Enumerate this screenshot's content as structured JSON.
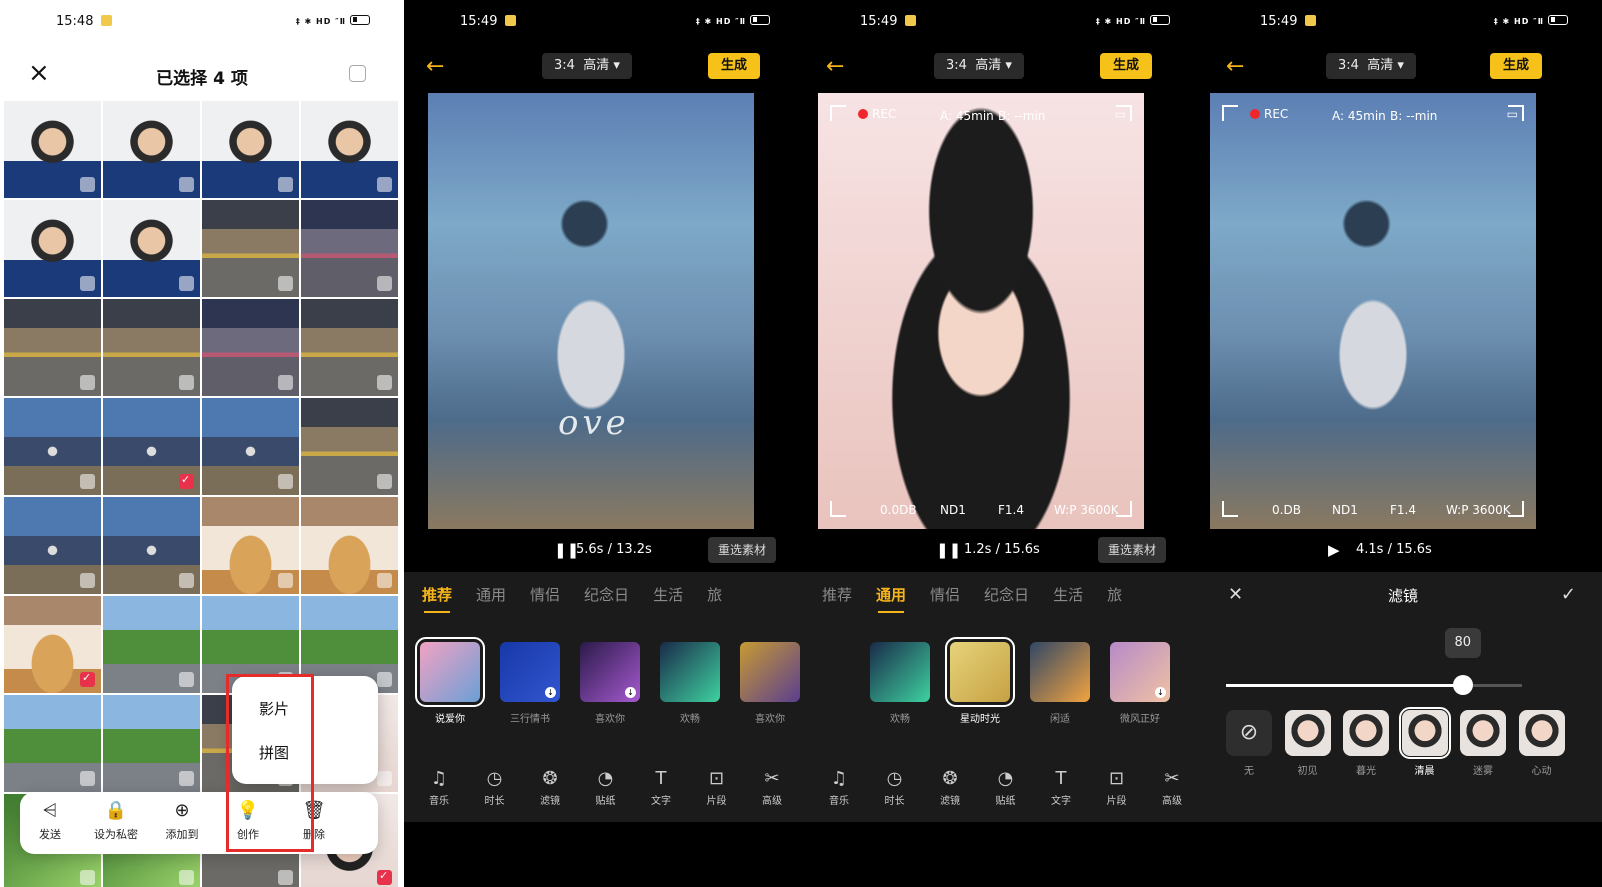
{
  "screen1": {
    "time": "15:48",
    "status_icons": "‡ ✱ HD ″Ⅱ",
    "title": "已选择 4 项",
    "grid": [
      {
        "type": "p-face",
        "checked": false
      },
      {
        "type": "p-face",
        "checked": false
      },
      {
        "type": "p-face",
        "checked": false
      },
      {
        "type": "p-face",
        "checked": false
      },
      {
        "type": "p-face",
        "checked": false
      },
      {
        "type": "p-face",
        "checked": false
      },
      {
        "type": "p-street",
        "checked": false
      },
      {
        "type": "p-street2",
        "checked": false
      },
      {
        "type": "p-street",
        "checked": false
      },
      {
        "type": "p-street",
        "checked": false
      },
      {
        "type": "p-street2",
        "checked": false
      },
      {
        "type": "p-street",
        "checked": false
      },
      {
        "type": "p-night",
        "checked": false
      },
      {
        "type": "p-night",
        "checked": true
      },
      {
        "type": "p-night",
        "checked": false
      },
      {
        "type": "p-street",
        "checked": false
      },
      {
        "type": "p-night",
        "checked": false
      },
      {
        "type": "p-night",
        "checked": false
      },
      {
        "type": "p-cup",
        "checked": false
      },
      {
        "type": "p-cup",
        "checked": false
      },
      {
        "type": "p-cup",
        "checked": true
      },
      {
        "type": "p-tree",
        "checked": false
      },
      {
        "type": "p-tree",
        "checked": false
      },
      {
        "type": "p-tree",
        "checked": false
      },
      {
        "type": "p-tree",
        "checked": false
      },
      {
        "type": "p-tree",
        "checked": false
      },
      {
        "type": "p-street",
        "checked": false
      },
      {
        "type": "p-girl",
        "checked": false
      },
      {
        "type": "p-leaf",
        "checked": false
      },
      {
        "type": "p-leaf",
        "checked": false
      },
      {
        "type": "p-street",
        "checked": false
      },
      {
        "type": "p-girl",
        "checked": true
      }
    ],
    "popup": {
      "item1": "影片",
      "item2": "拼图"
    },
    "actions": [
      {
        "icon": "share-icon",
        "glyph": "⩤",
        "label": "发送"
      },
      {
        "icon": "lock-icon",
        "glyph": "🔒",
        "label": "设为私密"
      },
      {
        "icon": "plus-circle-icon",
        "glyph": "⊕",
        "label": "添加到"
      },
      {
        "icon": "bulb-icon",
        "glyph": "💡",
        "label": "创作"
      },
      {
        "icon": "trash-icon",
        "glyph": "🗑",
        "label": "删除"
      }
    ]
  },
  "editor": {
    "back_glyph": "←",
    "ratio": "3:4",
    "quality": "高清",
    "generate_label": "生成",
    "reselect_label": "重选素材",
    "tabs": [
      "推荐",
      "通用",
      "情侣",
      "纪念日",
      "生活",
      "旅"
    ],
    "tools": [
      {
        "icon": "music-icon",
        "glyph": "♫",
        "label": "音乐"
      },
      {
        "icon": "clock-icon",
        "glyph": "◷",
        "label": "时长"
      },
      {
        "icon": "filter-icon",
        "glyph": "❂",
        "label": "滤镜"
      },
      {
        "icon": "sticker-icon",
        "glyph": "◔",
        "label": "贴纸"
      },
      {
        "icon": "text-icon",
        "glyph": "T",
        "label": "文字"
      },
      {
        "icon": "clip-icon",
        "glyph": "⊡",
        "label": "片段"
      },
      {
        "icon": "scissors-icon",
        "glyph": "✂",
        "label": "高级"
      }
    ]
  },
  "screen2": {
    "time": "15:49",
    "timecode": "5.6s / 13.2s",
    "play_glyph": "❚❚",
    "overlay_text": "ove",
    "active_tab": 0,
    "templates": [
      {
        "name": "说爱你",
        "cls": "th-a",
        "selected": true,
        "download": false
      },
      {
        "name": "三行情书",
        "cls": "th-b",
        "selected": false,
        "download": true
      },
      {
        "name": "喜欢你",
        "cls": "th-c",
        "selected": false,
        "download": true
      },
      {
        "name": "欢畅",
        "cls": "th-d",
        "selected": false,
        "download": false
      },
      {
        "name": "喜欢你",
        "cls": "th-e",
        "selected": false,
        "download": false
      }
    ]
  },
  "screen3": {
    "time": "15:49",
    "timecode": "1.2s / 15.6s",
    "play_glyph": "❚❚",
    "active_tab": 1,
    "rec": {
      "label": "REC",
      "a": "A: 45min",
      "b": "B: --min",
      "db": "0.0DB",
      "nd": "ND1",
      "f": "F1.4",
      "wp": "W:P 3600K"
    },
    "templates": [
      {
        "name": "欢畅",
        "cls": "th-d",
        "selected": false,
        "download": false
      },
      {
        "name": "星动时光",
        "cls": "th-f",
        "selected": true,
        "download": false
      },
      {
        "name": "闲适",
        "cls": "th-g",
        "selected": false,
        "download": false
      },
      {
        "name": "微风正好",
        "cls": "th-h",
        "selected": false,
        "download": true
      }
    ]
  },
  "screen4": {
    "time": "15:49",
    "timecode": "4.1s / 15.6s",
    "play_glyph": "▶",
    "rec": {
      "label": "REC",
      "a": "A: 45min",
      "b": "B: --min",
      "db": "0.DB",
      "nd": "ND1",
      "f": "F1.4",
      "wp": "W:P 3600K"
    },
    "filter_title": "滤镜",
    "close_glyph": "✕",
    "confirm_glyph": "✓",
    "slider_value": "80",
    "slider_fraction": 0.8,
    "filters": [
      {
        "name": "无",
        "none": true,
        "selected": false
      },
      {
        "name": "初见",
        "none": false,
        "selected": false
      },
      {
        "name": "暮光",
        "none": false,
        "selected": false
      },
      {
        "name": "清晨",
        "none": false,
        "selected": true
      },
      {
        "name": "迷雾",
        "none": false,
        "selected": false
      },
      {
        "name": "心动",
        "none": false,
        "selected": false
      }
    ]
  }
}
